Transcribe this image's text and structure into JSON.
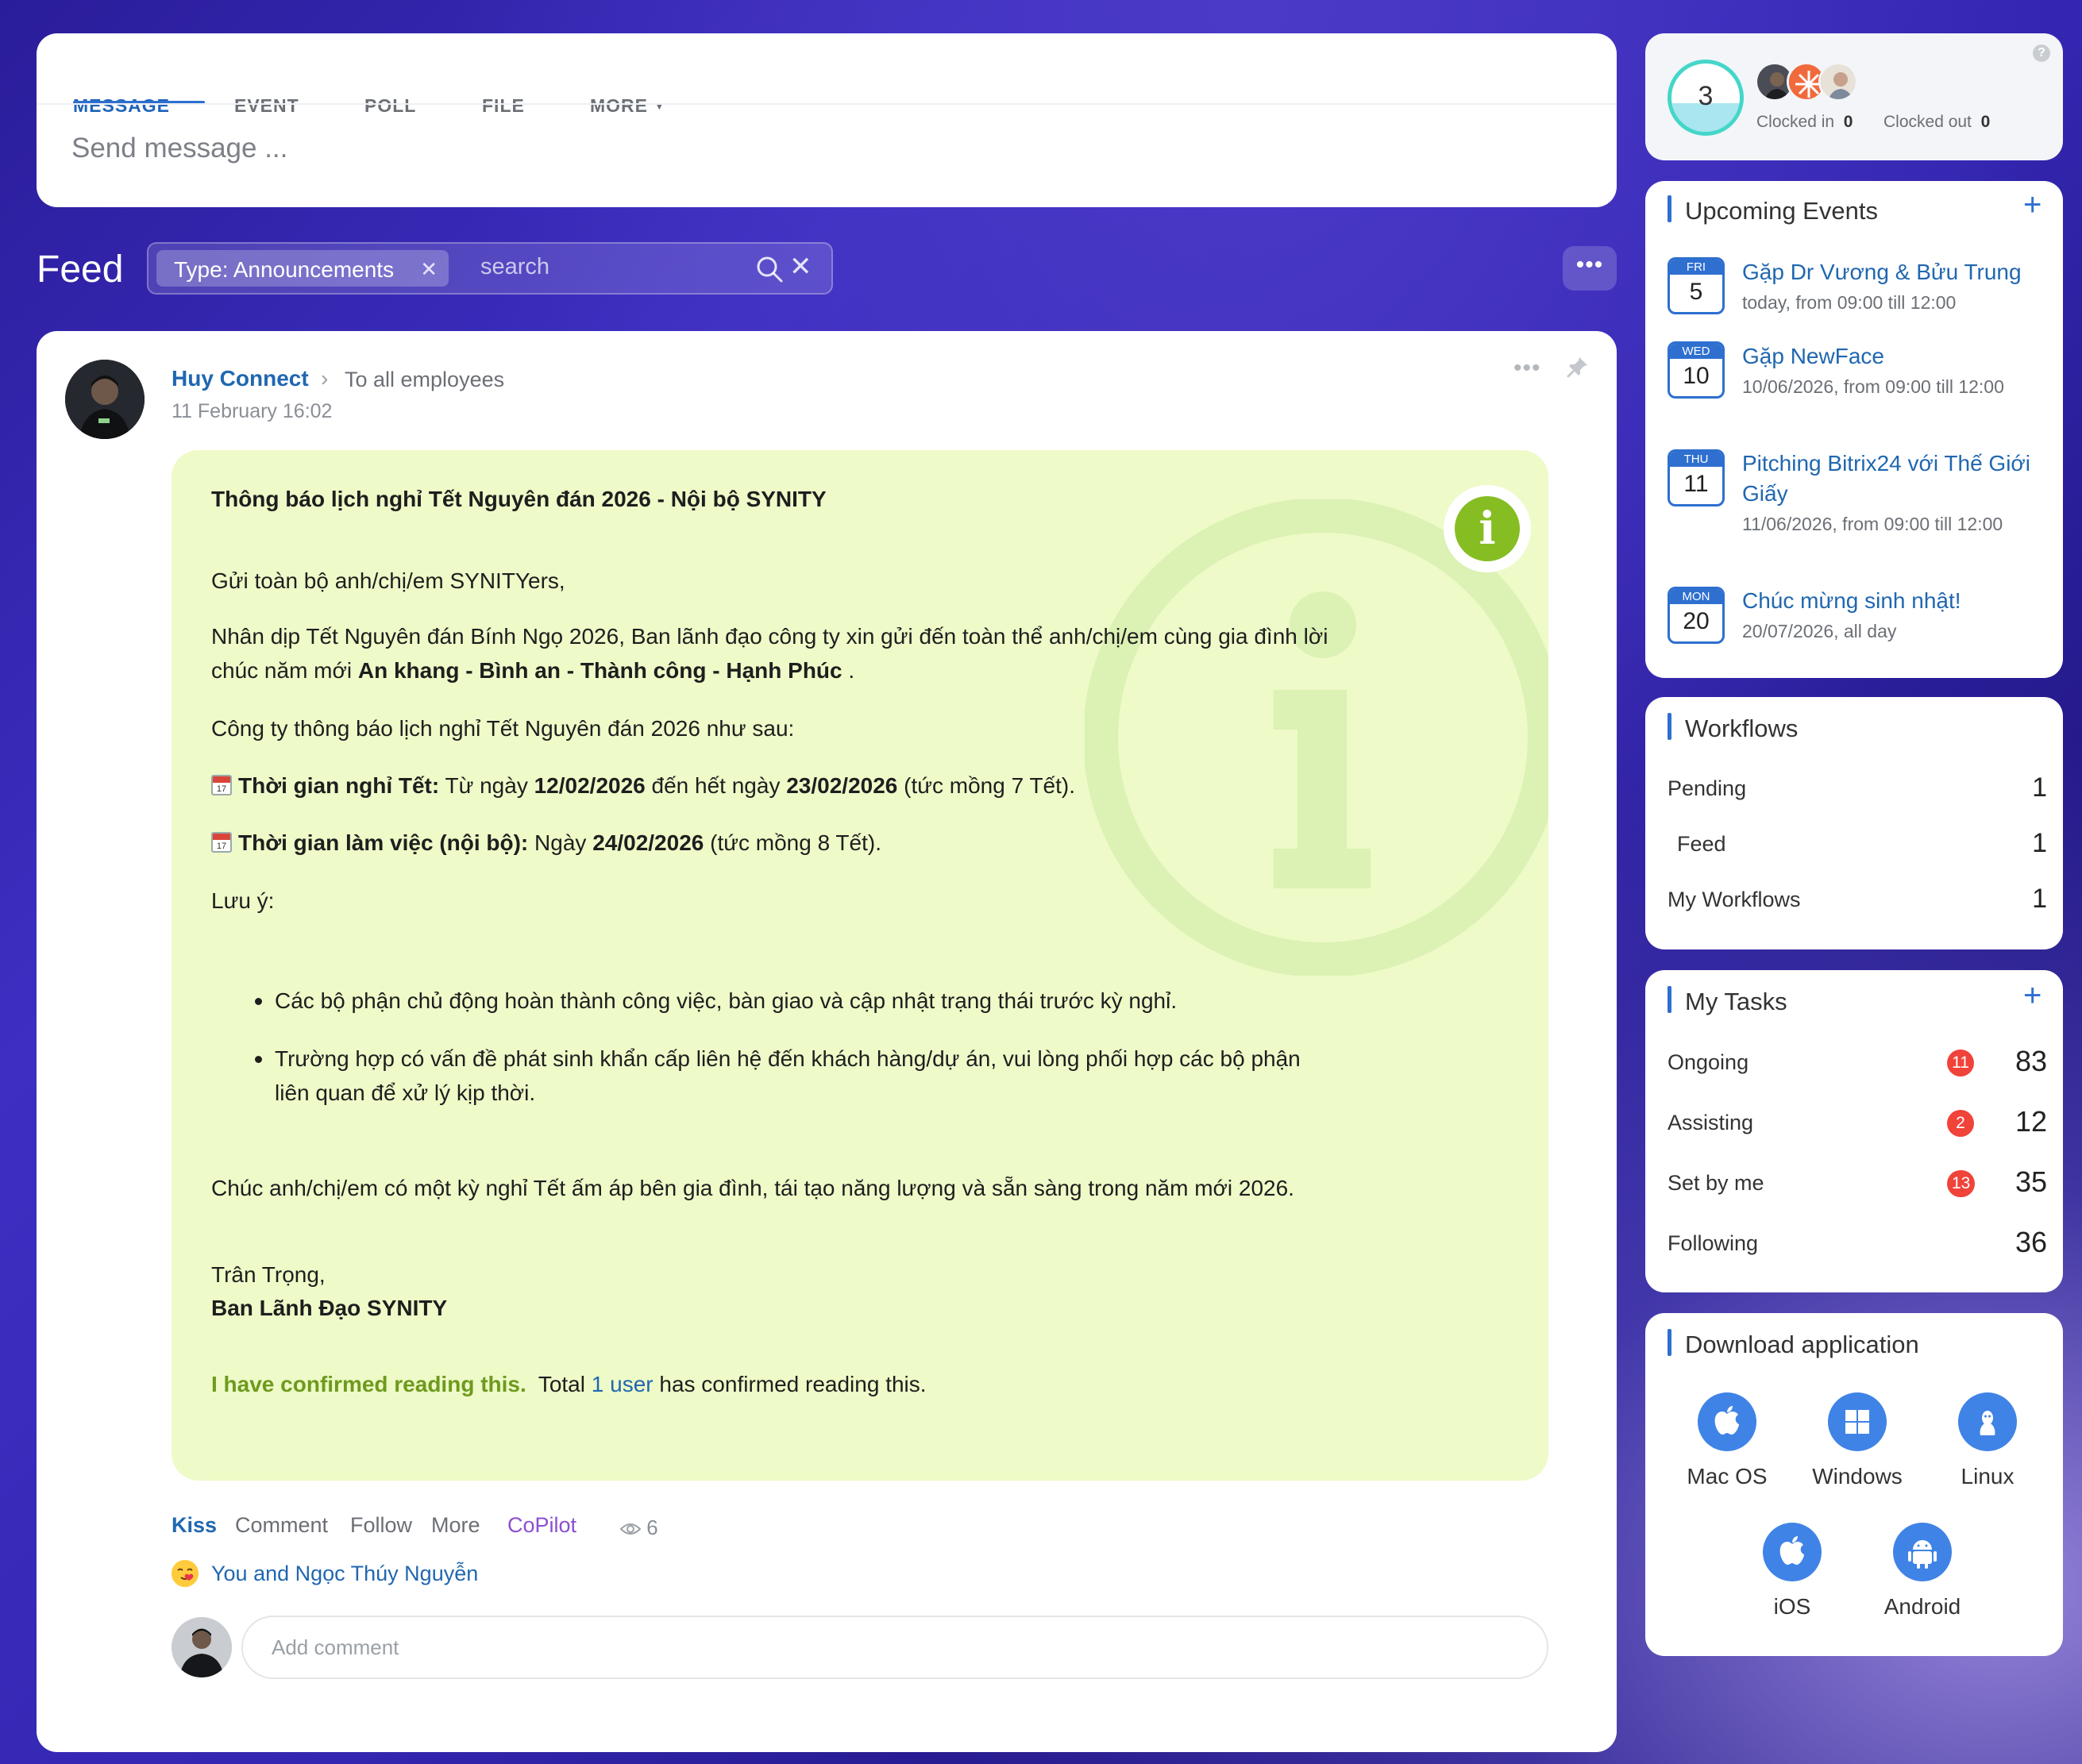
{
  "composer": {
    "tabs": [
      {
        "label": "MESSAGE",
        "active": true
      },
      {
        "label": "EVENT"
      },
      {
        "label": "POLL"
      },
      {
        "label": "FILE"
      },
      {
        "label": "MORE"
      }
    ],
    "placeholder": "Send message ..."
  },
  "feed": {
    "title": "Feed",
    "filter_chip": "Type: Announcements",
    "search_placeholder": "search",
    "more_button": "•••"
  },
  "post": {
    "author": "Huy Connect",
    "recipient": "To all employees",
    "date": "11 February 16:02",
    "announcement": {
      "title": "Thông báo lịch nghỉ Tết Nguyên đán 2026 - Nội bộ SYNITY",
      "greeting": "Gửi toàn bộ anh/chị/em SYNITYers,",
      "intro": "Nhân dịp Tết Nguyên đán Bính Ngọ 2026, Ban lãnh đạo công ty xin gửi đến toàn thể anh/chị/em cùng gia đình lời chúc năm mới",
      "intro_bold": "An khang - Bình an - Thành công - Hạnh Phúc",
      "intro_end": ".",
      "schedule_intro": "Công ty thông báo lịch nghỉ Tết Nguyên đán 2026 như sau:",
      "calendar_icon_number": "17",
      "holiday_label": "Thời gian nghỉ Tết:",
      "holiday_text_1": "Từ ngày",
      "holiday_start": "12/02/2026",
      "holiday_text_2": "đến hết ngày",
      "holiday_end": "23/02/2026",
      "holiday_text_3": "(tức mồng 7 Tết).",
      "work_label": "Thời gian làm việc (nội bộ):",
      "work_text_1": "Ngày",
      "work_date": "24/02/2026",
      "work_text_2": "(tức mồng 8 Tết).",
      "note_label": "Lưu ý:",
      "notes": [
        "Các bộ phận chủ động hoàn thành công việc, bàn giao và cập nhật trạng thái trước kỳ nghỉ.",
        "Trường hợp có vấn đề phát sinh khẩn cấp liên hệ đến khách hàng/dự án, vui lòng phối hợp các bộ phận liên quan để xử lý kịp thời."
      ],
      "closing": "Chúc anh/chị/em có một kỳ nghỉ Tết ấm áp bên gia đình, tái tạo năng lượng và sẵn sàng trong năm mới 2026.",
      "regards": "Trân Trọng,",
      "signature": "Ban Lãnh Đạo SYNITY",
      "confirm_button": "I have confirmed reading this.",
      "confirm_total": "Total",
      "confirm_users": "1 user",
      "confirm_suffix": "has confirmed reading this."
    },
    "actions": {
      "kiss": "Kiss",
      "comment": "Comment",
      "follow": "Follow",
      "more": "More",
      "copilot": "CoPilot",
      "views": "6"
    },
    "reactions_text": "You and Ngọc Thúy Nguyễn",
    "comment_placeholder": "Add comment"
  },
  "sidebar": {
    "clock": {
      "count": "3",
      "clocked_in_label": "Clocked in",
      "clocked_in_value": "0",
      "clocked_out_label": "Clocked out",
      "clocked_out_value": "0",
      "help": "?"
    },
    "events": {
      "title": "Upcoming Events",
      "add": "+",
      "items": [
        {
          "dow": "FRI",
          "day": "5",
          "title": "Gặp Dr Vương & Bửu Trung",
          "when": "today, from 09:00 till 12:00"
        },
        {
          "dow": "WED",
          "day": "10",
          "title": "Gặp NewFace",
          "when": "10/06/2026, from 09:00 till 12:00"
        },
        {
          "dow": "THU",
          "day": "11",
          "title": "Pitching Bitrix24 với Thế Giới Giấy",
          "when": "11/06/2026, from 09:00 till 12:00"
        },
        {
          "dow": "MON",
          "day": "20",
          "title": "Chúc mừng sinh nhật!",
          "when": "20/07/2026, all day"
        }
      ]
    },
    "workflows": {
      "title": "Workflows",
      "rows": [
        {
          "label": "Pending",
          "value": "1"
        },
        {
          "label": "Feed",
          "value": "1"
        },
        {
          "label": "My Workflows",
          "value": "1"
        }
      ]
    },
    "tasks": {
      "title": "My Tasks",
      "add": "+",
      "rows": [
        {
          "label": "Ongoing",
          "badge": "11",
          "value": "83"
        },
        {
          "label": "Assisting",
          "badge": "2",
          "value": "12"
        },
        {
          "label": "Set by me",
          "badge": "13",
          "value": "35"
        },
        {
          "label": "Following",
          "badge": "",
          "value": "36"
        }
      ]
    },
    "download": {
      "title": "Download application",
      "apps": [
        "Mac OS",
        "Windows",
        "Linux",
        "iOS",
        "Android"
      ]
    }
  }
}
